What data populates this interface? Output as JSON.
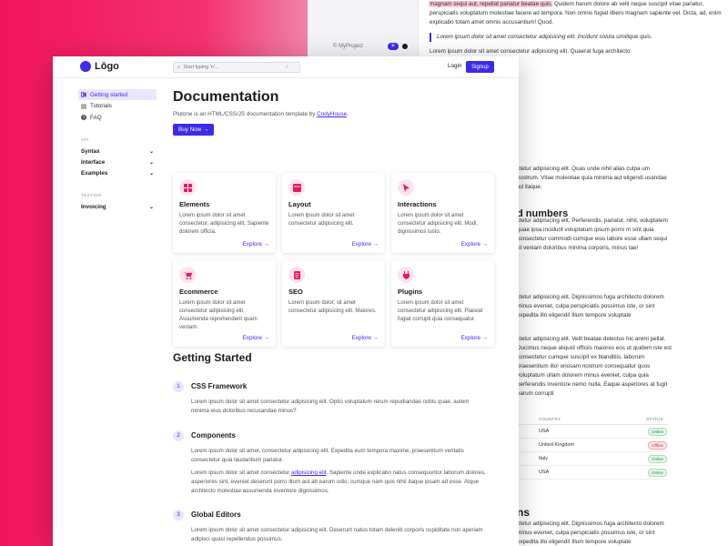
{
  "background": {
    "footer_copyright": "© MyProject",
    "paragraphs": {
      "p1_highlight": "magnam sequi aut, repellat pariatur beatae quis.",
      "p1_rest": " Quidem harum dolore ab velit neque suscipit vitae pariatur, perspiciatis voluptatum molestiae facere ad tempora. Non omnis fugiat libero magnam sapiente vel. Dicta, ad, enim explicabo totam amet omnis accusantium! Quod.",
      "quote": "Lorem ipsum dolor sit amet consectetur adipisicing elit. Incidunt soluta similique quis.",
      "p2": "Lorem ipsum dolor sit amet consectetur adipisicing elit. Quaerat fuga architecto"
    },
    "right_column": {
      "block1": "ctetur adipisicing elit. Quas unde nihil alias culpa um nostrum. Vitae molestiae quia minima aut eligendi usandae ad itaque.",
      "heading1": "d numbers",
      "block2": "ctetur adipisicing elit. Perferendis, pariatur, nihil, voluptatem quae ipsa incidunt voluptatum ipsum porro m sint quia consectetur commodi cumque eius labore esse ullam sequi ut veniam doloribus minima corporis, minus tae!",
      "block3": "ctetur adipisicing elit. Dignissimos fuga architecto dolorem minus eveniet, culpa perspiciatis possimus iste, or sint expedita illo eligendi! Illum tempore voluptate",
      "block4": "ctetur adipisicing elit. Velit beatae delectus hic animi pellat. Ducimus neque aliquid officiis maiores eos ut quidem iste est consectetur cumque suscipit ex blanditiis, laborum praesentium illo! oriosam nostrum consequatur quos voluptatum ullam dolorem minus eveniet, culpa quia perferendis inventore nemo nulla. Eaque asperiores at fugit earum corrupti",
      "heading2": "ns",
      "block5": "ctetur adipisicing elit. Dignissimos fuga architecto dolorem minus eveniet, culpa perspiciatis possimus iste, or sint expedita illo eligendi! Illum tempore voluptate"
    },
    "table": {
      "headers": [
        "COUNTRY",
        "STATUS"
      ],
      "rows": [
        {
          "country": "USA",
          "status": "Online",
          "kind": "on"
        },
        {
          "country": "United Kingdom",
          "status": "Offline",
          "kind": "off"
        },
        {
          "country": "Italy",
          "status": "Online",
          "kind": "on"
        },
        {
          "country": "USA",
          "status": "Online",
          "kind": "on"
        }
      ]
    }
  },
  "topbar": {
    "logo_text": "Lōgo",
    "search_placeholder": "Start typing 'n'...",
    "search_shortcut": "/",
    "login_label": "Login",
    "signup_label": "Signup"
  },
  "sidebar": {
    "items": [
      {
        "label": "Getting started",
        "icon": "book-icon"
      },
      {
        "label": "Tutorials",
        "icon": "list-icon"
      },
      {
        "label": "FAQ",
        "icon": "question-icon"
      }
    ],
    "category_api": "API",
    "api_groups": [
      "Syntax",
      "Interface",
      "Examples"
    ],
    "category_testing": "TESTING",
    "testing_groups": [
      "Invoicing"
    ]
  },
  "main": {
    "title": "Documentation",
    "subtitle_prefix": "Plutone is an HTML/CSS/JS documentation template by ",
    "subtitle_link": "CodyHouse",
    "subtitle_suffix": ".",
    "buy_label": "Buy Now →",
    "cards": [
      {
        "title": "Elements",
        "desc": "Lorem ipsum dolor sit amet consectetur, adipisicing elit. Sapiente dolorem officia.",
        "link": "Explore →"
      },
      {
        "title": "Layout",
        "desc": "Lorem ipsum dolor sit amet consectetur adipisicing elit.",
        "link": "Explore →"
      },
      {
        "title": "Interactions",
        "desc": "Lorem ipsum dolor sit amet consectetur adipisicing elit. Modi, dignissimos iusto.",
        "link": "Explore →"
      },
      {
        "title": "Ecommerce",
        "desc": "Lorem ipsum dolor sit amet consectetur adipisicing elit. Assumenda reprehenderit quam veniam.",
        "link": "Explore →"
      },
      {
        "title": "SEO",
        "desc": "Lorem ipsum dolor, sit amet consectetur adipisicing elit. Maiores.",
        "link": "Explore →"
      },
      {
        "title": "Plugins",
        "desc": "Lorem ipsum dolor sit amet consectetur adipisicing elit. Placeat fugiat corrupti quia consequatur.",
        "link": "Explore →"
      }
    ],
    "getting_started_title": "Getting Started",
    "steps": [
      {
        "num": "1",
        "title": "CSS Framework",
        "text": "Lorem ipsum dolor sit amet consectetur adipisicing elit. Optio voluptatum rerum repudiandae nobis quae, autem minima eius doloribus recusandae minus?"
      },
      {
        "num": "2",
        "title": "Components",
        "text": "Lorem ipsum dolor sit amet, consectetur adipisicing elit. Expedita eum tempora maxime, praesentium veritatis consectetur quia laudantium pariatur.",
        "text2_prefix": "Lorem ipsum dolor sit amet consectetur ",
        "text2_link": "adipisicing elit",
        "text2_suffix": ". Sapiente unde explicabo natus consequuntur laborum dolores, asperiores sint, eveniet deserunt porro illum aut ab earum odio, cumque nam quis nihil itaque ipsam ad esse. Atque architecto molestiae assumenda inventore dignissimos."
      },
      {
        "num": "3",
        "title": "Global Editors",
        "text": "Lorem ipsum dolor sit amet consectetur adipisicing elit. Deserunt natus totam deleniti corporis cupiditate non aperiam adipisci quasi repellendus possimus."
      }
    ]
  },
  "colors": {
    "accent": "#3d2be8",
    "brand_pink": "#f0145a",
    "card_icon_bg": "#fde3eb"
  }
}
